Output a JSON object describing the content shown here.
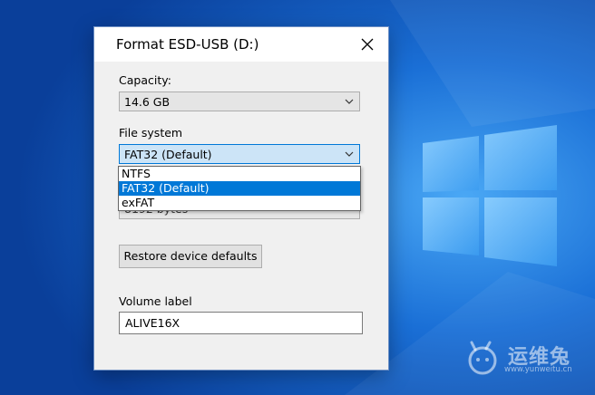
{
  "dialog": {
    "title": "Format ESD-USB (D:)",
    "capacity_label": "Capacity:",
    "capacity_value": "14.6 GB",
    "filesystem_label": "File system",
    "filesystem_value": "FAT32 (Default)",
    "filesystem_options": [
      "NTFS",
      "FAT32 (Default)",
      "exFAT"
    ],
    "obscured_allocation_value": "8192 bytes",
    "restore_button": "Restore device defaults",
    "volume_label": "Volume label",
    "volume_value": "ALIVE16X"
  },
  "watermark": {
    "text": "运维兔",
    "url": "www.yunweitu.cn"
  },
  "icons": {
    "close": "close-icon",
    "chevron": "chevron-down-icon",
    "windows_logo": "windows-logo-icon",
    "watermark_logo": "rabbit-logo-icon"
  },
  "colors": {
    "desktop_blue": "#0a4fb8",
    "accent": "#0078d7",
    "dialog_bg": "#f0f0f0"
  }
}
